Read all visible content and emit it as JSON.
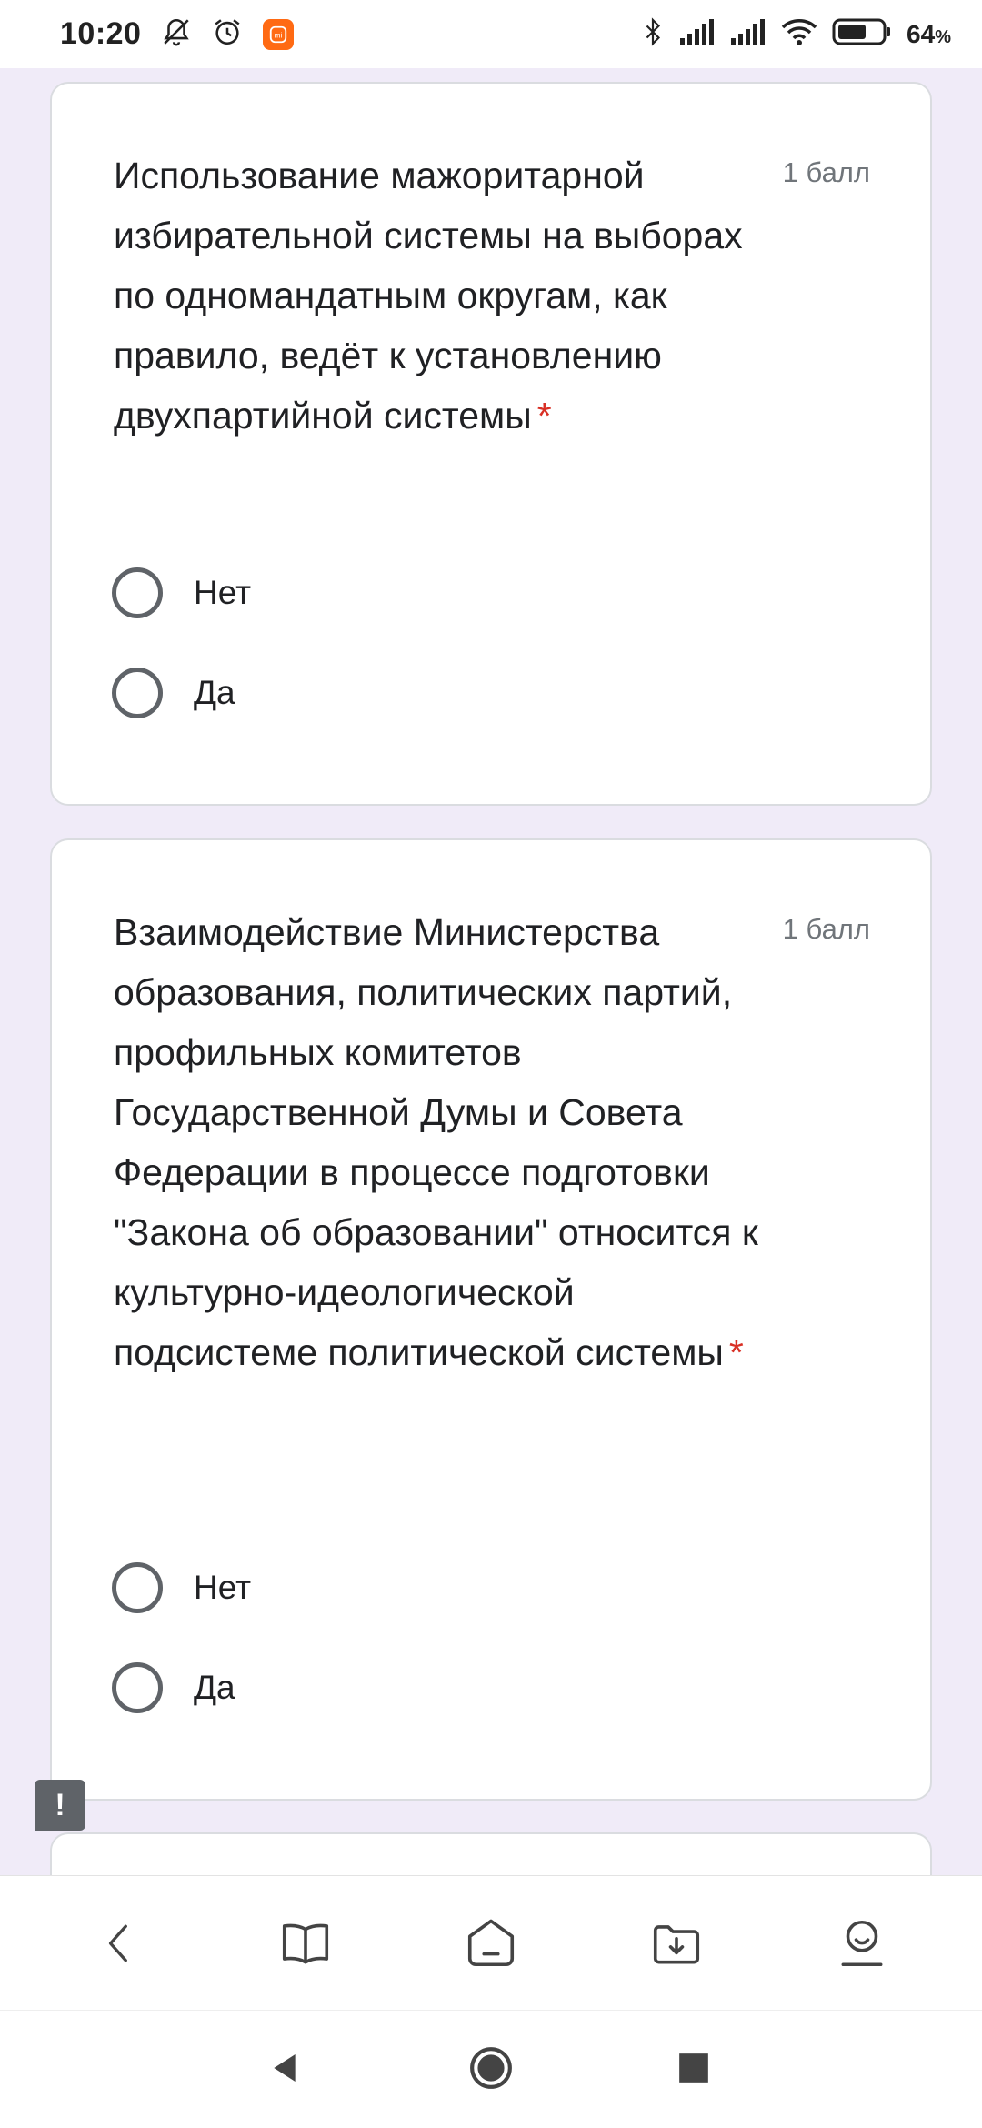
{
  "status_bar": {
    "time": "10:20",
    "battery_percent": "64",
    "battery_suffix": "%",
    "icons": [
      "mute-bell-icon",
      "alarm-icon",
      "mi-app-icon",
      "bluetooth-icon",
      "signal-icon",
      "signal-icon",
      "wifi-icon",
      "battery-icon"
    ]
  },
  "questions": [
    {
      "text": "Использование мажоритарной избирательной системы на выборах по одномандатным округам, как правило, ведёт к установлению двухпартийной системы",
      "required_mark": "*",
      "points": "1 балл",
      "options": [
        "Нет",
        "Да"
      ]
    },
    {
      "text": "Взаимодействие Министерства образования, политических партий, профильных комитетов Государственной Думы и Совета Федерации в процессе подготовки \"Закона об образовании\" относится к культурно-идеологической подсистеме политической системы",
      "required_mark": "*",
      "points": "1 балл",
      "options": [
        "Нет",
        "Да"
      ]
    }
  ],
  "feedback": {
    "label": "!"
  },
  "browser_toolbar": {
    "buttons": [
      "back-icon",
      "book-icon",
      "home-icon",
      "download-folder-icon",
      "profile-icon"
    ]
  },
  "nav_bar": {
    "buttons": [
      "nav-back-icon",
      "nav-home-icon",
      "nav-recents-icon"
    ]
  },
  "colors": {
    "background": "#f0ebf8",
    "required": "#d93025",
    "radio_border": "#5f6368",
    "mi_badge": "#ff6a13"
  }
}
